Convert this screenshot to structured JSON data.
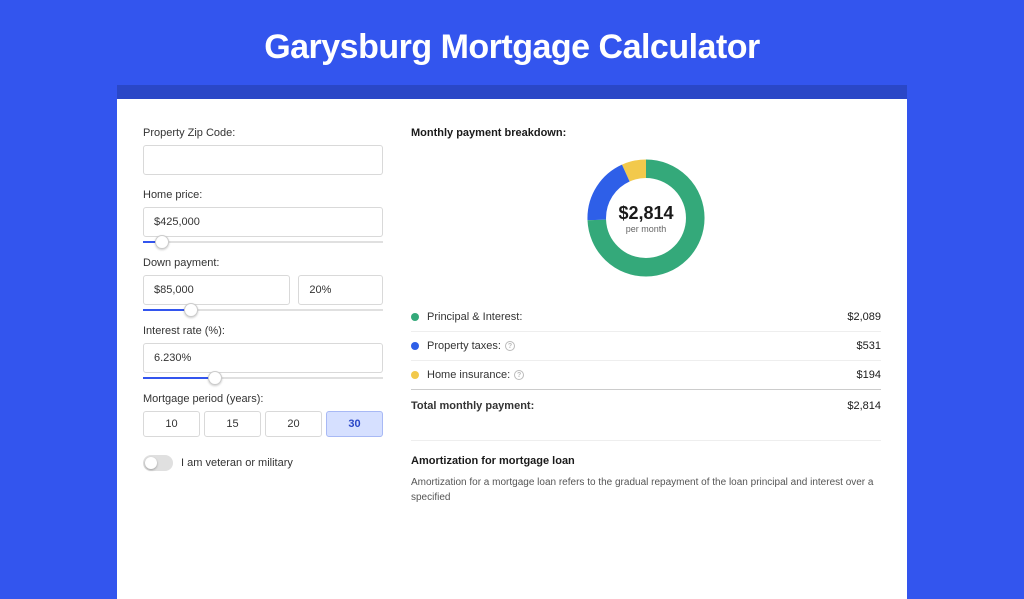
{
  "title": "Garysburg Mortgage Calculator",
  "colors": {
    "green": "#34a97a",
    "blue": "#2e5fe8",
    "yellow": "#f2c94c"
  },
  "form": {
    "zip_label": "Property Zip Code:",
    "zip_value": "",
    "home_price_label": "Home price:",
    "home_price_value": "$425,000",
    "home_price_slider_pct": 8,
    "down_payment_label": "Down payment:",
    "down_payment_value": "$85,000",
    "down_payment_pct_value": "20%",
    "down_payment_slider_pct": 20,
    "interest_label": "Interest rate (%):",
    "interest_value": "6.230%",
    "interest_slider_pct": 30,
    "period_label": "Mortgage period (years):",
    "period_options": [
      "10",
      "15",
      "20",
      "30"
    ],
    "period_active": "30",
    "veteran_label": "I am veteran or military"
  },
  "breakdown": {
    "title": "Monthly payment breakdown:",
    "center_amount": "$2,814",
    "center_sub": "per month",
    "items": [
      {
        "label": "Principal & Interest:",
        "value": "$2,089",
        "color": "green",
        "has_info": false
      },
      {
        "label": "Property taxes:",
        "value": "$531",
        "color": "blue",
        "has_info": true
      },
      {
        "label": "Home insurance:",
        "value": "$194",
        "color": "yellow",
        "has_info": true
      }
    ],
    "total_label": "Total monthly payment:",
    "total_value": "$2,814"
  },
  "amortization": {
    "title": "Amortization for mortgage loan",
    "text": "Amortization for a mortgage loan refers to the gradual repayment of the loan principal and interest over a specified"
  },
  "chart_data": {
    "type": "pie",
    "title": "Monthly payment breakdown",
    "series": [
      {
        "name": "Principal & Interest",
        "value": 2089,
        "color": "#34a97a"
      },
      {
        "name": "Property taxes",
        "value": 531,
        "color": "#2e5fe8"
      },
      {
        "name": "Home insurance",
        "value": 194,
        "color": "#f2c94c"
      }
    ],
    "total": 2814,
    "center_label": "$2,814 per month"
  }
}
